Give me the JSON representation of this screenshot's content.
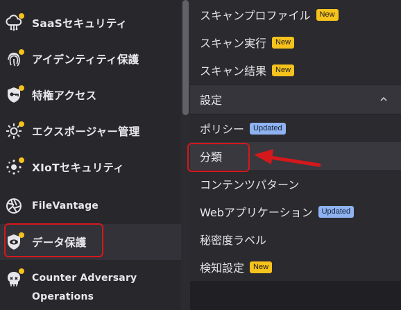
{
  "sidebar": {
    "items": [
      {
        "label": "SaaSセキュリティ",
        "icon": "cloud-network-icon"
      },
      {
        "label": "アイデンティティ保護",
        "icon": "fingerprint-icon"
      },
      {
        "label": "特権アクセス",
        "icon": "shield-key-icon"
      },
      {
        "label": "エクスポージャー管理",
        "icon": "sun-exposure-icon"
      },
      {
        "label": "XIoTセキュリティ",
        "icon": "iot-nodes-icon"
      },
      {
        "label": "FileVantage",
        "icon": "aperture-icon"
      },
      {
        "label": "データ保護",
        "icon": "eye-shield-icon"
      },
      {
        "label_line1": "Counter Adversary",
        "label_line2": "Operations",
        "icon": "adversary-skull-icon"
      }
    ]
  },
  "submenu": {
    "top_items": [
      {
        "label": "スキャンプロファイル",
        "badge": "New"
      },
      {
        "label": "スキャン実行",
        "badge": "New"
      },
      {
        "label": "スキャン結果",
        "badge": "New"
      }
    ],
    "section_title": "設定",
    "section_items": [
      {
        "label": "ポリシー",
        "badge": "Updated"
      },
      {
        "label": "分類"
      },
      {
        "label": "コンテンツパターン"
      },
      {
        "label": "Webアプリケーション",
        "badge": "Updated"
      },
      {
        "label": "秘密度ラベル"
      },
      {
        "label": "検知設定",
        "badge": "New"
      }
    ]
  },
  "colors": {
    "sidebar_bg": "#27272c",
    "panel_bg": "#2a2a2f",
    "accent_dot": "#f6c21c",
    "annotation_red": "#d4181c",
    "badge_new": "#f6c21c",
    "badge_updated": "#8fb3f0"
  }
}
